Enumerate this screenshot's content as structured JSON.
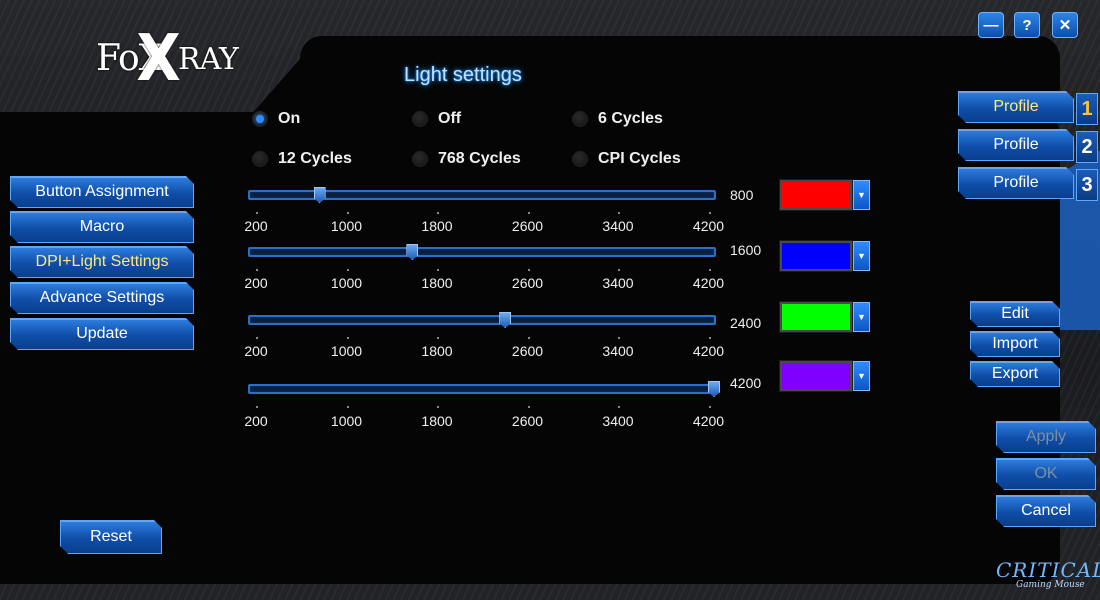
{
  "window": {
    "minimize_label": "—",
    "help_label": "?",
    "close_label": "✕"
  },
  "logo": {
    "fox": "FoX",
    "x": "X",
    "ray": "RAY"
  },
  "title": "Light settings",
  "menu": {
    "items": [
      {
        "label": "Button Assignment",
        "active": false
      },
      {
        "label": "Macro",
        "active": false
      },
      {
        "label": "DPI+Light Settings",
        "active": true
      },
      {
        "label": "Advance Settings",
        "active": false
      },
      {
        "label": "Update",
        "active": false
      }
    ],
    "reset_label": "Reset"
  },
  "light_modes": [
    {
      "label": "On",
      "selected": true
    },
    {
      "label": "Off",
      "selected": false
    },
    {
      "label": "6 Cycles",
      "selected": false
    },
    {
      "label": "12 Cycles",
      "selected": false
    },
    {
      "label": "768 Cycles",
      "selected": false
    },
    {
      "label": "CPI Cycles",
      "selected": false
    }
  ],
  "dpi_scale": {
    "min": 200,
    "max": 4200,
    "ticks": [
      "200",
      "1000",
      "1800",
      "2600",
      "3400",
      "4200"
    ]
  },
  "dpi_levels": [
    {
      "value": "800",
      "color": "#ff0000",
      "color_name": "red"
    },
    {
      "value": "1600",
      "color": "#0000ff",
      "color_name": "blue"
    },
    {
      "value": "2400",
      "color": "#00ff00",
      "color_name": "green"
    },
    {
      "value": "4200",
      "color": "#8000ff",
      "color_name": "purple"
    }
  ],
  "color_dropdown_icon": "▼",
  "profiles": [
    {
      "label": "Profile",
      "number": "1",
      "active": true
    },
    {
      "label": "Profile",
      "number": "2",
      "active": false
    },
    {
      "label": "Profile",
      "number": "3",
      "active": false
    }
  ],
  "profile_actions": {
    "edit": "Edit",
    "import": "Import",
    "export": "Export"
  },
  "bottom_actions": {
    "apply": "Apply",
    "ok": "OK",
    "cancel": "Cancel"
  },
  "brand": {
    "name": "CRITICAL",
    "tagline": "Gaming Mouse"
  },
  "accent_color": "#1e7de0"
}
